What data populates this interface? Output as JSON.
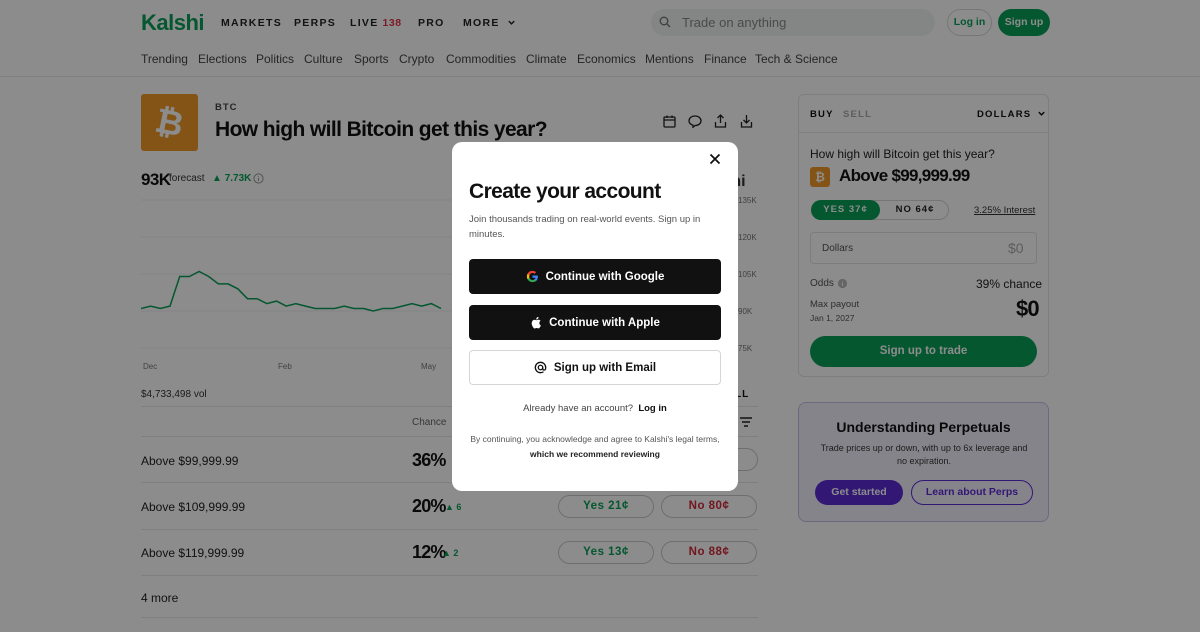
{
  "header": {
    "logo": "Kalshi",
    "nav": [
      "MARKETS",
      "PERPS",
      "LIVE",
      "PRO",
      "MORE"
    ],
    "live_count": "138",
    "search_placeholder": "Trade on anything",
    "login": "Log in",
    "signup": "Sign up"
  },
  "categories": [
    "Trending",
    "Elections",
    "Politics",
    "Culture",
    "Sports",
    "Crypto",
    "Commodities",
    "Climate",
    "Economics",
    "Mentions",
    "Finance",
    "Tech & Science"
  ],
  "market": {
    "tag": "BTC",
    "title": "How high will Bitcoin get this year?",
    "forecast_value": "93K",
    "forecast_label": "forecast",
    "forecast_delta": "7.73K",
    "watermark": "ishi",
    "y_ticks": [
      "135K",
      "120K",
      "105K",
      "90K",
      "75K"
    ],
    "x_ticks": [
      "Dec",
      "Feb",
      "May"
    ],
    "volume": "$4,733,498 vol",
    "list_header_chance": "Chance",
    "list_header_right": "LL",
    "more": "4 more",
    "rows": [
      {
        "label": "Above $99,999.99",
        "chance": "36%",
        "delta": "",
        "yes": "",
        "no": ""
      },
      {
        "label": "Above $109,999.99",
        "chance": "20%",
        "delta": "6",
        "yes": "Yes  21¢",
        "no": "No  80¢"
      },
      {
        "label": "Above $119,999.99",
        "chance": "12%",
        "delta": "2",
        "yes": "Yes  13¢",
        "no": "No  88¢"
      }
    ]
  },
  "chart_data": {
    "type": "line",
    "series": [
      {
        "values": [
          91,
          92,
          91,
          92,
          104,
          104,
          106,
          104,
          101,
          101,
          99,
          95,
          95,
          93,
          94,
          92,
          93,
          92,
          91,
          91,
          91,
          92,
          91,
          91,
          90,
          91,
          91,
          92,
          93,
          92,
          93,
          91
        ]
      }
    ],
    "ylim": [
      75,
      135
    ]
  },
  "trade": {
    "buy": "BUY",
    "sell": "SELL",
    "currency": "DOLLARS",
    "question": "How high will Bitcoin get this year?",
    "outcome": "Above $99,999.99",
    "yes": "YES 37¢",
    "no": "NO 64¢",
    "interest": "3.25% Interest",
    "amount_label": "Dollars",
    "amount_value": "$0",
    "odds_label": "Odds",
    "odds_value": "39% chance",
    "payout_label": "Max payout",
    "payout_date": "Jan 1, 2027",
    "payout_value": "$0",
    "cta": "Sign up to trade"
  },
  "perps_card": {
    "title": "Understanding Perpetuals",
    "desc": "Trade prices up or down, with up to 6x leverage and no expiration.",
    "get_started": "Get started",
    "learn": "Learn about Perps"
  },
  "modal": {
    "title": "Create your account",
    "subtitle": "Join thousands trading on real-world events. Sign up in minutes.",
    "google": "Continue with Google",
    "apple": "Continue with Apple",
    "email": "Sign up with Email",
    "have_account": "Already have an account?",
    "login": "Log in",
    "legal": "By continuing, you acknowledge and agree to Kalshi's legal terms,",
    "legal_link": "which we recommend reviewing"
  },
  "colors": {
    "brand": "#0a9e58",
    "no": "#d0283a",
    "btc": "#f09a2a",
    "perps": "#5b2bd6"
  }
}
